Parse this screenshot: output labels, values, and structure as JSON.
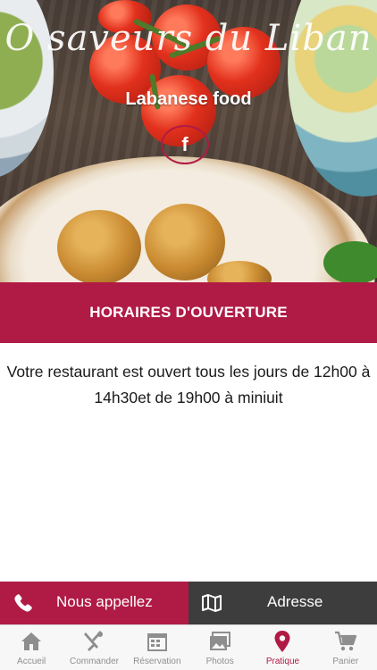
{
  "hero": {
    "title": "O saveurs du Liban",
    "subtitle": "Labanese food",
    "facebook_glyph": "f"
  },
  "section": {
    "title": "HORAIRES D'OUVERTURE",
    "text": "Votre restaurant est ouvert tous les jours de 12h00 à 14h30et de 19h00 à miniuit"
  },
  "actions": {
    "call_label": "Nous appellez",
    "address_label": "Adresse"
  },
  "tabs": [
    {
      "label": "Accueil",
      "icon": "home-icon"
    },
    {
      "label": "Commander",
      "icon": "fork-knife-icon"
    },
    {
      "label": "Réservation",
      "icon": "calendar-icon"
    },
    {
      "label": "Photos",
      "icon": "photos-icon"
    },
    {
      "label": "Pratique",
      "icon": "location-pin-icon",
      "active": true
    },
    {
      "label": "Panier",
      "icon": "cart-icon"
    }
  ],
  "colors": {
    "accent": "#b01b45",
    "dark_button": "#3d3d3d",
    "tab_inactive": "#8e8e8e"
  }
}
